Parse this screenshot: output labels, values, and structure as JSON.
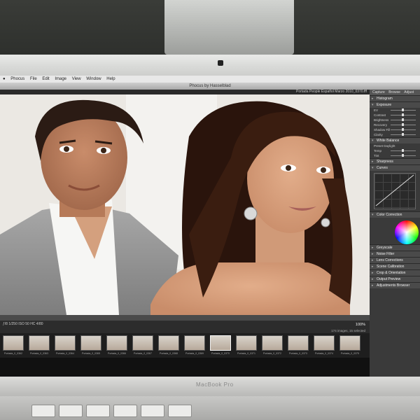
{
  "menubar": {
    "apple": "",
    "items": [
      "Phocus",
      "File",
      "Edit",
      "Image",
      "View",
      "Window",
      "Help"
    ]
  },
  "window": {
    "title": "Phocus by Hasselblad",
    "path": "Portada People Español Marzo 2010_0370.fff"
  },
  "panel": {
    "tabs": [
      "Capture",
      "Browse",
      "Adjust"
    ],
    "sections": [
      {
        "label": "Histogram",
        "open": false
      },
      {
        "label": "Exposure",
        "open": true,
        "rows": [
          "EV",
          "Contrast",
          "Brightness",
          "Recovery",
          "Shadow Fill",
          "Clarity"
        ]
      },
      {
        "label": "White Balance",
        "open": true,
        "rows": [
          "Preset",
          "Temp",
          "Tint"
        ],
        "preset": "Daylight"
      },
      {
        "label": "Sharpness",
        "open": false
      },
      {
        "label": "Curves",
        "open": true
      },
      {
        "label": "Color Correction",
        "open": true
      },
      {
        "label": "Greyscale",
        "open": false
      },
      {
        "label": "Noise Filter",
        "open": false
      },
      {
        "label": "Lens Corrections",
        "open": false
      },
      {
        "label": "Scene Calibration",
        "open": false
      },
      {
        "label": "Crop & Orientation",
        "open": false
      },
      {
        "label": "Output Preview",
        "open": false
      },
      {
        "label": "Adjustments Browser",
        "open": false
      }
    ]
  },
  "infobar": {
    "status": "ƒ/8  1/250  ISO 50  HC 4/80",
    "zoom": "100%",
    "count": "174 images, 15 selected"
  },
  "filmstrip": {
    "thumbs": [
      "Portada_0_0362",
      "Portada_0_0363",
      "Portada_0_0364",
      "Portada_0_0365",
      "Portada_0_0366",
      "Portada_0_0367",
      "Portada_0_0368",
      "Portada_0_0369",
      "Portada_0_0370",
      "Portada_0_0371",
      "Portada_0_0372",
      "Portada_0_0373",
      "Portada_0_0374",
      "Portada_0_0375"
    ]
  },
  "laptop": {
    "brand": "MacBook Pro"
  },
  "colors": {
    "app_dark": "#2c2c2c",
    "panel": "#3a3a3a",
    "bezel": "#d9d9d7"
  }
}
